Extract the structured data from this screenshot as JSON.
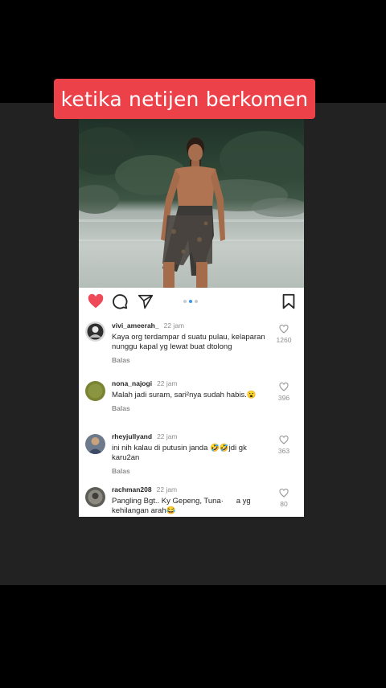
{
  "caption": {
    "text": "ketika netijen berkomen"
  },
  "post": {
    "icons": {
      "like": "heart-filled-icon",
      "comment": "comment-bubble-icon",
      "share": "paper-plane-icon",
      "save": "bookmark-icon"
    },
    "carousel": {
      "count": 3,
      "active": 1
    },
    "accent_like_color": "#ed4956",
    "accent_dot_color": "#3897f0"
  },
  "comments": [
    {
      "user": "vivi_ameerah_",
      "time": "22 jam",
      "text": "Kaya org terdampar d suatu pulau, kelaparan nunggu kapal yg lewat buat dtolong",
      "reply": "Balas",
      "likes": "1260"
    },
    {
      "user": "nona_najogi",
      "time": "22 jam",
      "text": "Malah jadi suram, sari²nya sudah habis.😮",
      "reply": "Balas",
      "likes": "396"
    },
    {
      "user": "rheyjullyand",
      "time": "22 jam",
      "text": "ini nih kalau di putusin janda 🤣🤣jdi gk karu2an",
      "reply": "Balas",
      "likes": "363"
    },
    {
      "user": "rachman208",
      "time": "22 jam",
      "text": "Pangling Bgt.. Ky Gepeng, Tuna·      a yg kehilangan arah😂",
      "reply": "",
      "likes": "80"
    }
  ]
}
